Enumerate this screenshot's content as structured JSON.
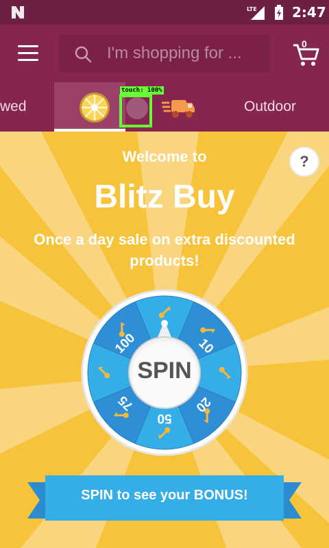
{
  "status_bar": {
    "time": "2:47",
    "network": "LTE"
  },
  "toolbar": {
    "search_placeholder": "I'm shopping for ...",
    "cart_count": "0"
  },
  "tabs": [
    {
      "label": "wed"
    },
    {
      "label": ""
    },
    {
      "label": "Outdoor"
    }
  ],
  "touch_indicator": {
    "label": "touch: 100%"
  },
  "promo": {
    "welcome": "Welcome to",
    "title": "Blitz Buy",
    "subtitle": "Once a day sale on extra discounted products!",
    "help": "?",
    "spin_button": "SPIN",
    "wheel_segments": [
      "100",
      "10",
      "20",
      "50",
      "75"
    ],
    "banner": "SPIN to see your BONUS!"
  },
  "colors": {
    "status_bar": "#6e1f44",
    "toolbar": "#86254f",
    "promo_background": "#f6c33a",
    "wheel_blue": "#2e8fd6",
    "wheel_light_blue": "#35aee8",
    "banner_blue": "#35aee8"
  }
}
